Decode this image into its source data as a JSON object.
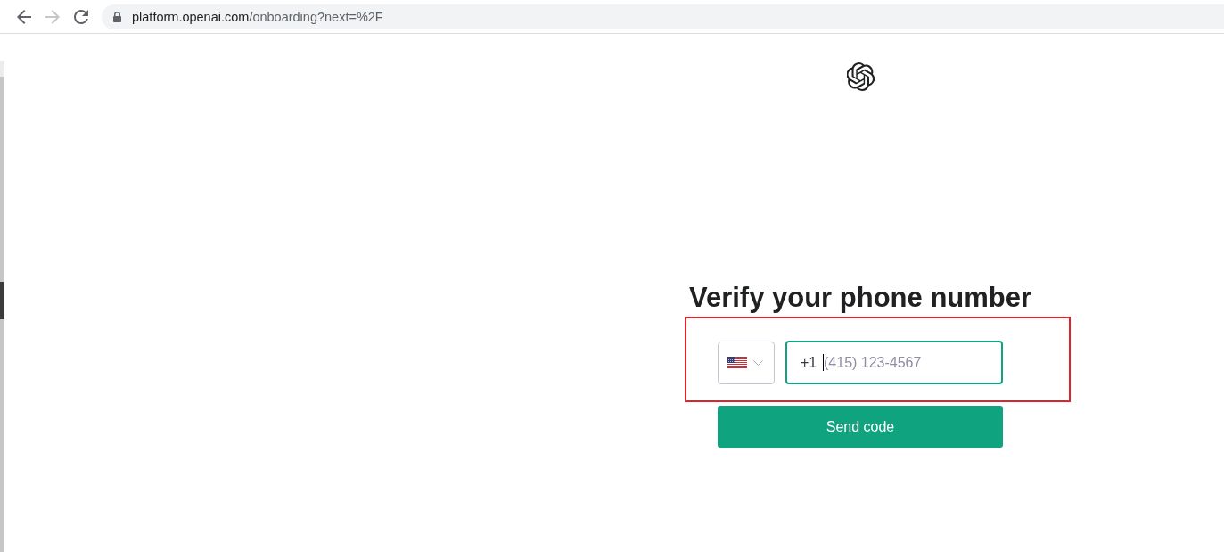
{
  "browser": {
    "nav_buttons": [
      {
        "kind": "back",
        "disabled": false
      },
      {
        "kind": "forward",
        "disabled": true
      },
      {
        "kind": "reload",
        "disabled": false
      }
    ],
    "address_bar": {
      "host": "platform.openai.com",
      "path": "/onboarding?next=%2F"
    }
  },
  "page": {
    "heading": "Verify your phone number",
    "phone_field": {
      "prefix": "+1",
      "placeholder": "(415) 123-4567",
      "focused": true
    },
    "send_button": {
      "label": "Send code"
    }
  }
}
